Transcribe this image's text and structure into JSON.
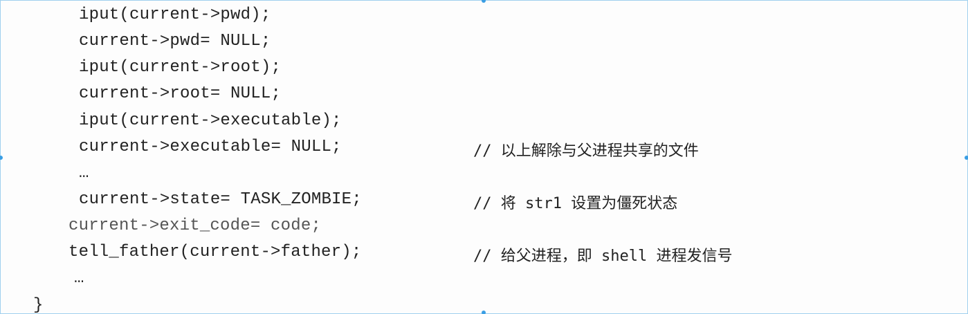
{
  "code": {
    "lines": [
      "iput(current->pwd);",
      "current->pwd= NULL;",
      "iput(current->root);",
      "current->root= NULL;",
      "iput(current->executable);",
      "current->executable= NULL;",
      "…",
      "current->state= TASK_ZOMBIE;",
      "current->exit_code= code;",
      "tell_father(current->father);",
      "…",
      "}"
    ],
    "comments": {
      "executable": "// 以上解除与父进程共享的文件",
      "state": "// 将 str1 设置为僵死状态",
      "tell_father": "// 给父进程，即 shell 进程发信号"
    }
  }
}
